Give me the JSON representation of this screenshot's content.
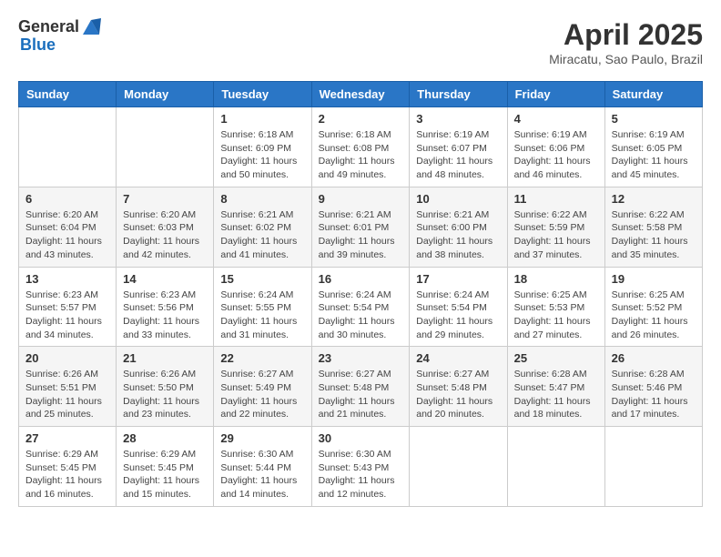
{
  "header": {
    "logo_general": "General",
    "logo_blue": "Blue",
    "title": "April 2025",
    "location": "Miracatu, Sao Paulo, Brazil"
  },
  "weekdays": [
    "Sunday",
    "Monday",
    "Tuesday",
    "Wednesday",
    "Thursday",
    "Friday",
    "Saturday"
  ],
  "weeks": [
    [
      {
        "day": "",
        "info": ""
      },
      {
        "day": "",
        "info": ""
      },
      {
        "day": "1",
        "info": "Sunrise: 6:18 AM\nSunset: 6:09 PM\nDaylight: 11 hours and 50 minutes."
      },
      {
        "day": "2",
        "info": "Sunrise: 6:18 AM\nSunset: 6:08 PM\nDaylight: 11 hours and 49 minutes."
      },
      {
        "day": "3",
        "info": "Sunrise: 6:19 AM\nSunset: 6:07 PM\nDaylight: 11 hours and 48 minutes."
      },
      {
        "day": "4",
        "info": "Sunrise: 6:19 AM\nSunset: 6:06 PM\nDaylight: 11 hours and 46 minutes."
      },
      {
        "day": "5",
        "info": "Sunrise: 6:19 AM\nSunset: 6:05 PM\nDaylight: 11 hours and 45 minutes."
      }
    ],
    [
      {
        "day": "6",
        "info": "Sunrise: 6:20 AM\nSunset: 6:04 PM\nDaylight: 11 hours and 43 minutes."
      },
      {
        "day": "7",
        "info": "Sunrise: 6:20 AM\nSunset: 6:03 PM\nDaylight: 11 hours and 42 minutes."
      },
      {
        "day": "8",
        "info": "Sunrise: 6:21 AM\nSunset: 6:02 PM\nDaylight: 11 hours and 41 minutes."
      },
      {
        "day": "9",
        "info": "Sunrise: 6:21 AM\nSunset: 6:01 PM\nDaylight: 11 hours and 39 minutes."
      },
      {
        "day": "10",
        "info": "Sunrise: 6:21 AM\nSunset: 6:00 PM\nDaylight: 11 hours and 38 minutes."
      },
      {
        "day": "11",
        "info": "Sunrise: 6:22 AM\nSunset: 5:59 PM\nDaylight: 11 hours and 37 minutes."
      },
      {
        "day": "12",
        "info": "Sunrise: 6:22 AM\nSunset: 5:58 PM\nDaylight: 11 hours and 35 minutes."
      }
    ],
    [
      {
        "day": "13",
        "info": "Sunrise: 6:23 AM\nSunset: 5:57 PM\nDaylight: 11 hours and 34 minutes."
      },
      {
        "day": "14",
        "info": "Sunrise: 6:23 AM\nSunset: 5:56 PM\nDaylight: 11 hours and 33 minutes."
      },
      {
        "day": "15",
        "info": "Sunrise: 6:24 AM\nSunset: 5:55 PM\nDaylight: 11 hours and 31 minutes."
      },
      {
        "day": "16",
        "info": "Sunrise: 6:24 AM\nSunset: 5:54 PM\nDaylight: 11 hours and 30 minutes."
      },
      {
        "day": "17",
        "info": "Sunrise: 6:24 AM\nSunset: 5:54 PM\nDaylight: 11 hours and 29 minutes."
      },
      {
        "day": "18",
        "info": "Sunrise: 6:25 AM\nSunset: 5:53 PM\nDaylight: 11 hours and 27 minutes."
      },
      {
        "day": "19",
        "info": "Sunrise: 6:25 AM\nSunset: 5:52 PM\nDaylight: 11 hours and 26 minutes."
      }
    ],
    [
      {
        "day": "20",
        "info": "Sunrise: 6:26 AM\nSunset: 5:51 PM\nDaylight: 11 hours and 25 minutes."
      },
      {
        "day": "21",
        "info": "Sunrise: 6:26 AM\nSunset: 5:50 PM\nDaylight: 11 hours and 23 minutes."
      },
      {
        "day": "22",
        "info": "Sunrise: 6:27 AM\nSunset: 5:49 PM\nDaylight: 11 hours and 22 minutes."
      },
      {
        "day": "23",
        "info": "Sunrise: 6:27 AM\nSunset: 5:48 PM\nDaylight: 11 hours and 21 minutes."
      },
      {
        "day": "24",
        "info": "Sunrise: 6:27 AM\nSunset: 5:48 PM\nDaylight: 11 hours and 20 minutes."
      },
      {
        "day": "25",
        "info": "Sunrise: 6:28 AM\nSunset: 5:47 PM\nDaylight: 11 hours and 18 minutes."
      },
      {
        "day": "26",
        "info": "Sunrise: 6:28 AM\nSunset: 5:46 PM\nDaylight: 11 hours and 17 minutes."
      }
    ],
    [
      {
        "day": "27",
        "info": "Sunrise: 6:29 AM\nSunset: 5:45 PM\nDaylight: 11 hours and 16 minutes."
      },
      {
        "day": "28",
        "info": "Sunrise: 6:29 AM\nSunset: 5:45 PM\nDaylight: 11 hours and 15 minutes."
      },
      {
        "day": "29",
        "info": "Sunrise: 6:30 AM\nSunset: 5:44 PM\nDaylight: 11 hours and 14 minutes."
      },
      {
        "day": "30",
        "info": "Sunrise: 6:30 AM\nSunset: 5:43 PM\nDaylight: 11 hours and 12 minutes."
      },
      {
        "day": "",
        "info": ""
      },
      {
        "day": "",
        "info": ""
      },
      {
        "day": "",
        "info": ""
      }
    ]
  ]
}
